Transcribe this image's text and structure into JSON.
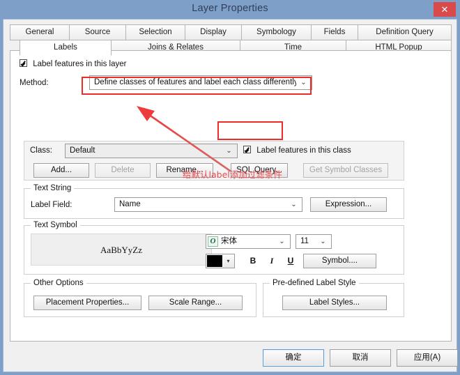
{
  "window": {
    "title": "Layer Properties",
    "close_label": "✕"
  },
  "tabs": {
    "row1": [
      {
        "label": "General",
        "active": false
      },
      {
        "label": "Source",
        "active": false
      },
      {
        "label": "Selection",
        "active": false
      },
      {
        "label": "Display",
        "active": false
      },
      {
        "label": "Symbology",
        "active": false
      },
      {
        "label": "Fields",
        "active": false
      },
      {
        "label": "Definition Query",
        "active": false
      }
    ],
    "row2": [
      {
        "label": "Labels",
        "active": true
      },
      {
        "label": "Joins & Relates",
        "active": false
      },
      {
        "label": "Time",
        "active": false
      },
      {
        "label": "HTML Popup",
        "active": false
      }
    ]
  },
  "labels_tab": {
    "label_features_layer": {
      "text": "Label features in this layer",
      "checked": true
    },
    "method": {
      "label": "Method:",
      "value": "Define classes of features and label each class differently.",
      "arrow": "⌄"
    },
    "class_panel": {
      "class_label": "Class:",
      "class_value": "Default",
      "class_arrow": "⌄",
      "label_features_class": {
        "text": "Label features in this class",
        "checked": true
      },
      "buttons": [
        {
          "label": "Add...",
          "enabled": true
        },
        {
          "label": "Delete",
          "enabled": false
        },
        {
          "label": "Rename...",
          "enabled": true
        },
        {
          "label": "SQL Query...",
          "enabled": true
        },
        {
          "label": "Get Symbol Classes",
          "enabled": false
        }
      ]
    },
    "text_string": {
      "group_title": "Text String",
      "field_label": "Label Field:",
      "field_value": "Name",
      "field_arrow": "⌄",
      "expression_button": "Expression..."
    },
    "text_symbol": {
      "group_title": "Text Symbol",
      "preview_text": "AaBbYyZz",
      "font_name": "宋体",
      "font_icon": "O",
      "font_size": "11",
      "arrow": "⌄",
      "color": "#000000",
      "bold": "B",
      "italic": "I",
      "underline": "U",
      "symbol_button": "Symbol...."
    },
    "other_options": {
      "group_title": "Other Options",
      "placement_button": "Placement Properties...",
      "scale_button": "Scale Range..."
    },
    "predefined_style": {
      "group_title": "Pre-defined Label Style",
      "label_styles_button": "Label Styles..."
    }
  },
  "footer": {
    "ok": "确定",
    "cancel": "取消",
    "apply": "应用(A)"
  },
  "annotations": {
    "note_text": "给默认label添加过滤条件",
    "highlight_color": "#ee2b2b"
  }
}
